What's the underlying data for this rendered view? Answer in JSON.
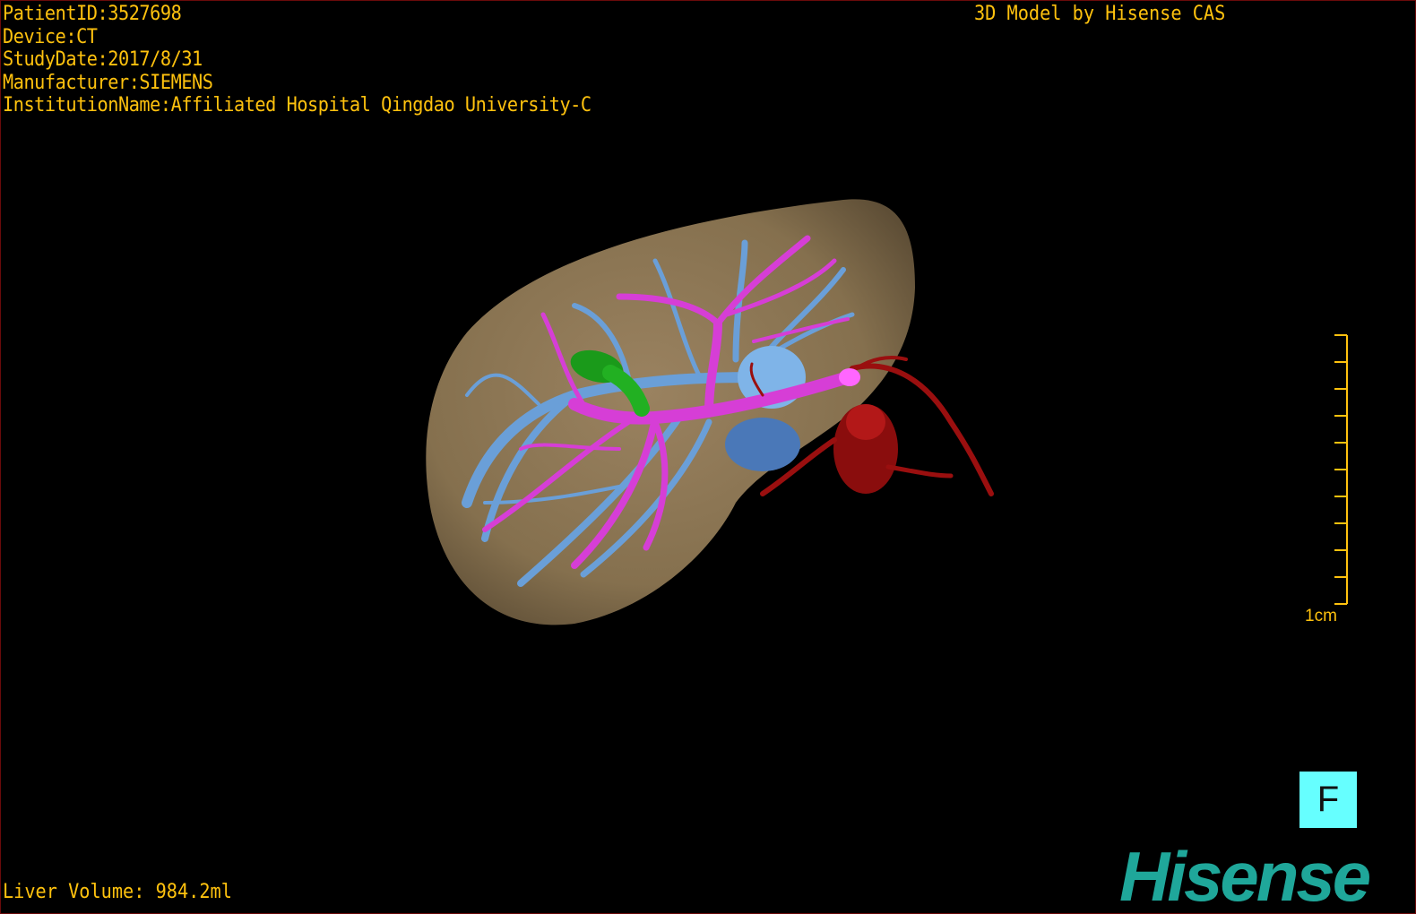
{
  "overlay": {
    "patient_id": "PatientID:3527698",
    "device": "Device:CT",
    "study_date": "StudyDate:2017/8/31",
    "manufacturer": "Manufacturer:SIEMENS",
    "institution": "InstitutionName:Affiliated Hospital Qingdao University-C",
    "brand_caption": "3D Model by Hisense CAS",
    "liver_volume": "Liver Volume: 984.2ml"
  },
  "scale_bar": {
    "label": "1cm",
    "ticks": 11
  },
  "orientation": {
    "label": "F",
    "color": "#66ffff"
  },
  "logo": {
    "text": "Hisense",
    "color": "#1fa79a"
  },
  "colors": {
    "text": "#ffc20e",
    "liver": "#8a7350",
    "hepatic_vein": "#6a9fd8",
    "portal_vein": "#d63ed6",
    "artery": "#9a0f0f",
    "gallbladder": "#1a9a1a",
    "ivc": "#4a78b8"
  }
}
